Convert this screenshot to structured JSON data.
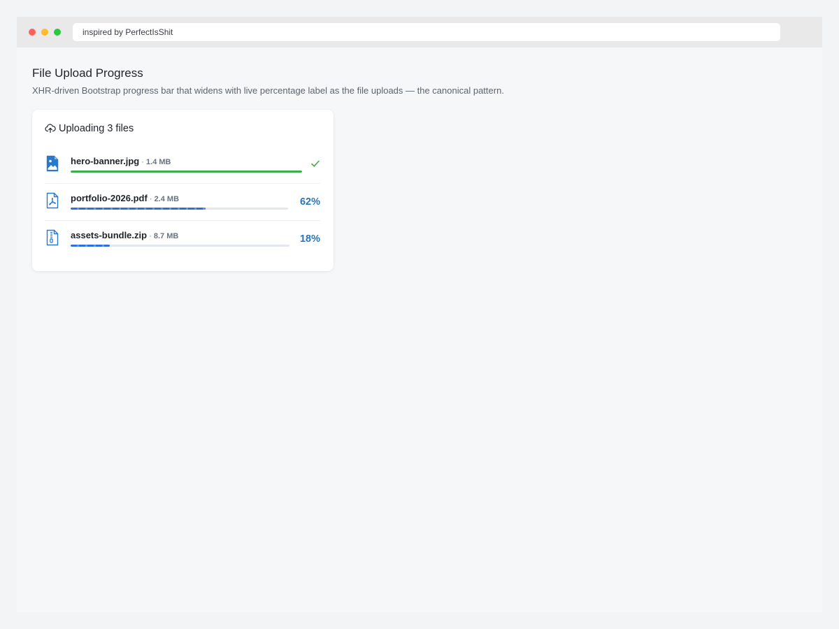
{
  "browser": {
    "url_text": "inspired by PerfectIsShit",
    "traffic_lights": [
      "#ff5f57",
      "#febc2e",
      "#28c840"
    ]
  },
  "page": {
    "title": "File Upload Progress",
    "description": "XHR-driven Bootstrap progress bar that widens with live percentage label as the file uploads — the canonical pattern."
  },
  "upload_card": {
    "header_icon": "cloud-upload-icon",
    "header": "Uploading 3 files",
    "files": [
      {
        "icon": "image-file-icon",
        "name": "hero-banner.jpg",
        "separator": " · ",
        "size": "1.4 MB",
        "progress": 1.0,
        "status": "complete",
        "status_icon": "checkmark-icon"
      },
      {
        "icon": "pdf-file-icon",
        "name": "portfolio-2026.pdf",
        "separator": " · ",
        "size": "2.4 MB",
        "progress": 0.62,
        "percent_label": "62%",
        "status": "uploading"
      },
      {
        "icon": "zip-file-icon",
        "name": "assets-bundle.zip",
        "separator": " · ",
        "size": "8.7 MB",
        "progress": 0.18,
        "percent_label": "18%",
        "status": "uploading"
      }
    ]
  },
  "colors": {
    "complete": "#3bae4c",
    "progress": "#2f6fdc",
    "percent_text": "#2a74b8",
    "file_icon": "#2a79c9"
  }
}
